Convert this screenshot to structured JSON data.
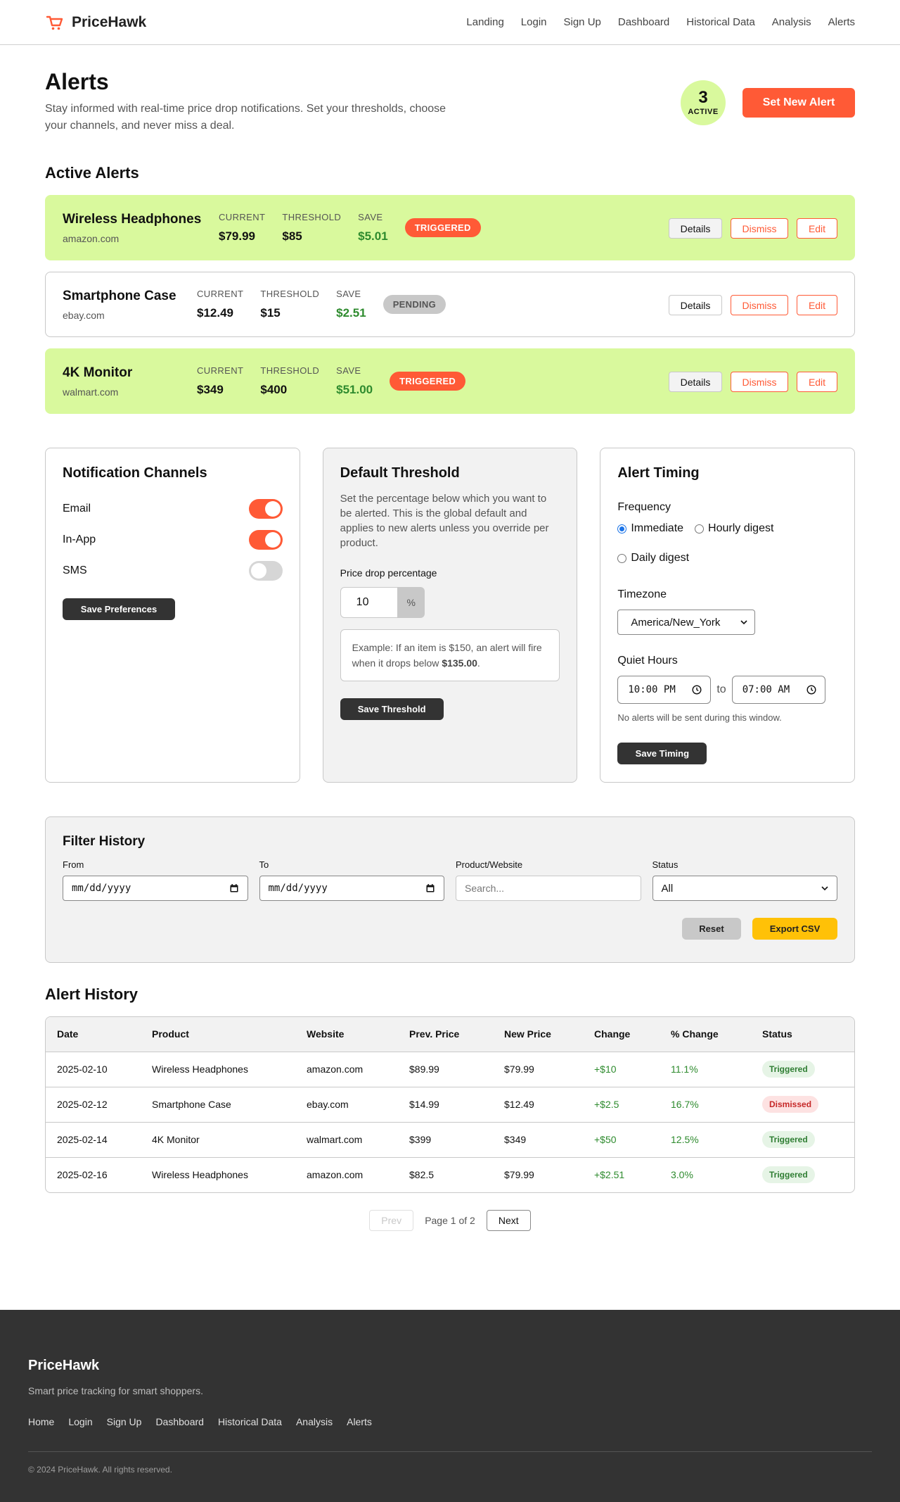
{
  "brand": {
    "name": "PriceHawk",
    "accent": "#ff5a36"
  },
  "nav": {
    "links": [
      "Landing",
      "Login",
      "Sign Up",
      "Dashboard",
      "Historical Data",
      "Analysis",
      "Alerts"
    ]
  },
  "header": {
    "title": "Alerts",
    "description": "Stay informed with real-time price drop notifications. Set your thresholds, choose your channels, and never miss a deal.",
    "active_count": "3",
    "active_label": "ACTIVE",
    "new_alert_label": "Set New Alert"
  },
  "active_alerts": {
    "title": "Active Alerts",
    "stat_labels": {
      "current": "CURRENT",
      "threshold": "THRESHOLD",
      "save": "SAVE"
    },
    "actions": {
      "details": "Details",
      "dismiss": "Dismiss",
      "edit": "Edit"
    },
    "items": [
      {
        "name": "Wireless Headphones",
        "site": "amazon.com",
        "current": "$79.99",
        "threshold": "$85",
        "save": "$5.01",
        "status": "TRIGGERED"
      },
      {
        "name": "Smartphone Case",
        "site": "ebay.com",
        "current": "$12.49",
        "threshold": "$15",
        "save": "$2.51",
        "status": "PENDING"
      },
      {
        "name": "4K Monitor",
        "site": "walmart.com",
        "current": "$349",
        "threshold": "$400",
        "save": "$51.00",
        "status": "TRIGGERED"
      }
    ]
  },
  "channels": {
    "title": "Notification Channels",
    "items": [
      {
        "label": "Email",
        "enabled": true
      },
      {
        "label": "In-App",
        "enabled": true
      },
      {
        "label": "SMS",
        "enabled": false
      }
    ],
    "save_label": "Save Preferences"
  },
  "threshold": {
    "title": "Default Threshold",
    "description": "Set the percentage below which you want to be alerted. This is the global default and applies to new alerts unless you override per product.",
    "field_label": "Price drop percentage",
    "value": "10",
    "suffix": "%",
    "example_prefix": "Example: If an item is $150, an alert will fire when it drops below ",
    "example_value": "$135.00",
    "example_suffix": ".",
    "save_label": "Save Threshold"
  },
  "timing": {
    "title": "Alert Timing",
    "frequency_label": "Frequency",
    "frequency_options": [
      "Immediate",
      "Hourly digest",
      "Daily digest"
    ],
    "frequency_selected": "Immediate",
    "timezone_label": "Timezone",
    "timezone_value": "America/New_York",
    "quiet_label": "Quiet Hours",
    "quiet_from": "10:00 PM",
    "quiet_to_text": "to",
    "quiet_to": "07:00 AM",
    "quiet_note": "No alerts will be sent during this window.",
    "save_label": "Save Timing"
  },
  "filter": {
    "title": "Filter History",
    "from_label": "From",
    "from_value": "mm/dd/yyyy",
    "to_label": "To",
    "to_value": "mm/dd/yyyy",
    "product_label": "Product/Website",
    "product_placeholder": "Search...",
    "status_label": "Status",
    "status_value": "All",
    "reset_label": "Reset",
    "export_label": "Export CSV"
  },
  "history": {
    "title": "Alert History",
    "columns": [
      "Date",
      "Product",
      "Website",
      "Prev. Price",
      "New Price",
      "Change",
      "% Change",
      "Status"
    ],
    "rows": [
      [
        "2025-02-10",
        "Wireless Headphones",
        "amazon.com",
        "$89.99",
        "$79.99",
        "+$10",
        "11.1%",
        "Triggered"
      ],
      [
        "2025-02-12",
        "Smartphone Case",
        "ebay.com",
        "$14.99",
        "$12.49",
        "+$2.5",
        "16.7%",
        "Dismissed"
      ],
      [
        "2025-02-14",
        "4K Monitor",
        "walmart.com",
        "$399",
        "$349",
        "+$50",
        "12.5%",
        "Triggered"
      ],
      [
        "2025-02-16",
        "Wireless Headphones",
        "amazon.com",
        "$82.5",
        "$79.99",
        "+$2.51",
        "3.0%",
        "Triggered"
      ]
    ]
  },
  "pagination": {
    "prev": "Prev",
    "page_text": "Page 1 of 2",
    "next": "Next"
  },
  "footer": {
    "brand": "PriceHawk",
    "tagline": "Smart price tracking for smart shoppers.",
    "links": [
      "Home",
      "Login",
      "Sign Up",
      "Dashboard",
      "Historical Data",
      "Analysis",
      "Alerts"
    ],
    "copyright": "© 2024 PriceHawk. All rights reserved."
  }
}
